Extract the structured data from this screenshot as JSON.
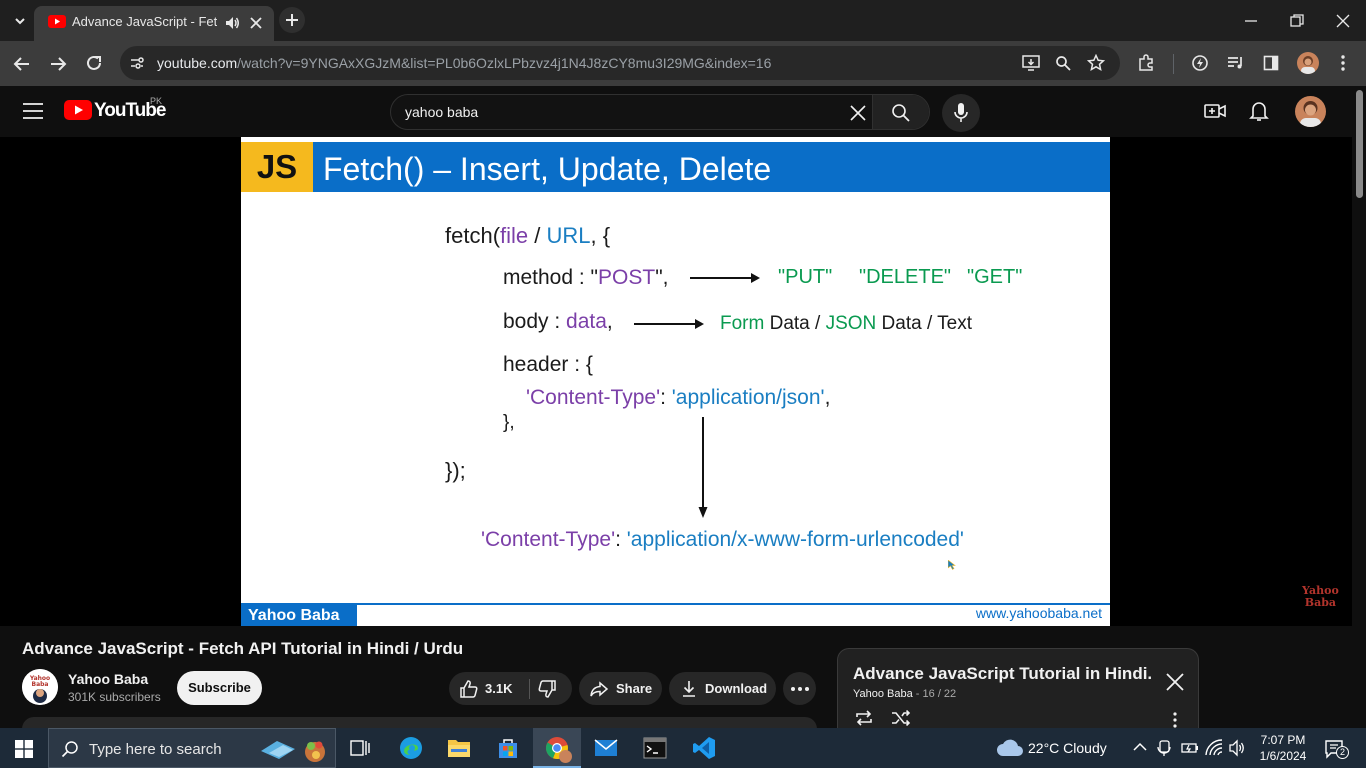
{
  "browser": {
    "tab_title": "Advance JavaScript - Fetch A",
    "url_host": "youtube.com",
    "url_path": "/watch?v=9YNGAxXGJzM&list=PL0b6OzlxLPbzvz4j1N4J8zCY8mu3I29MG&index=16"
  },
  "youtube": {
    "logo_text": "YouTube",
    "region": "PK",
    "search_query": "yahoo baba"
  },
  "slide": {
    "badge": "JS",
    "title": "Fetch() – Insert, Update, Delete",
    "fetch_open": "fetch(",
    "file": "file",
    "slash": " / ",
    "url": "URL",
    "fetch_open_end": ", {",
    "method_label": "method : \"",
    "method_value": "POST",
    "method_end": "\",",
    "alt_put": "\"PUT\"",
    "alt_delete": "\"DELETE\"",
    "alt_get": "\"GET\"",
    "body_label": "body : ",
    "body_value": "data",
    "body_end": ",",
    "form": "Form",
    "form_data": " Data / ",
    "json": "JSON",
    "json_data": " Data / Text",
    "header_label": "header : {",
    "ct_key": "'Content-Type'",
    "ct_colon": ": ",
    "ct_value": "'application/json'",
    "ct_comma": ",",
    "header_close": "},",
    "fetch_close": "});",
    "ct2_key": "'Content-Type'",
    "ct2_colon": ": ",
    "ct2_value": "'application/x-www-form-urlencoded'",
    "footer_brand": "Yahoo Baba",
    "footer_url": "www.yahoobaba.net",
    "watermark_1": "Yahoo",
    "watermark_2": "Baba"
  },
  "video": {
    "title": "Advance JavaScript - Fetch API Tutorial in Hindi / Urdu",
    "channel": "Yahoo Baba",
    "subscribers": "301K subscribers",
    "subscribe_label": "Subscribe",
    "likes": "3.1K",
    "share_label": "Share",
    "download_label": "Download"
  },
  "playlist": {
    "title": "Advance JavaScript Tutorial in Hindi...",
    "owner": "Yahoo Baba",
    "position": " - 16 / 22"
  },
  "taskbar": {
    "search_placeholder": "Type here to search",
    "weather": "22°C  Cloudy",
    "time": "7:07 PM",
    "date": "1/6/2024",
    "notifications": "2"
  },
  "colors": {
    "slide_blue": "#0a6ec8",
    "slide_yellow": "#f5b91e",
    "code_purple": "#7b3fa8",
    "code_blue": "#1a7ec2",
    "code_green": "#0a9a50",
    "yt_red": "#ff0000"
  }
}
